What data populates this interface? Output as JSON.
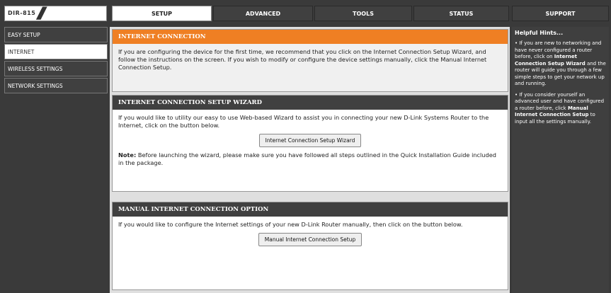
{
  "header": {
    "model": "DIR-815",
    "tabs": [
      "SETUP",
      "ADVANCED",
      "TOOLS",
      "STATUS",
      "SUPPORT"
    ]
  },
  "sidebar": {
    "items": [
      {
        "label": "EASY SETUP"
      },
      {
        "label": "INTERNET"
      },
      {
        "label": "WIRELESS SETTINGS"
      },
      {
        "label": "NETWORK SETTINGS"
      }
    ]
  },
  "main": {
    "section1": {
      "title": "INTERNET CONNECTION",
      "text": "If you are configuring the device for the first time, we recommend that you click on the Internet Connection Setup Wizard, and follow the instructions on the screen. If you wish to modify or configure the device settings manually, click the Manual Internet Connection Setup."
    },
    "section2": {
      "title": "INTERNET CONNECTION SETUP WIZARD",
      "text": "If you would like to utility our easy to use Web-based Wizard to assist you in connecting your new D-Link Systems Router to the Internet, click on the button below.",
      "button": "Internet Connection Setup Wizard",
      "note_label": "Note:",
      "note_text": " Before launching the wizard, please make sure you have followed all steps outlined in the Quick Installation Guide included in the package."
    },
    "section3": {
      "title": "MANUAL INTERNET CONNECTION OPTION",
      "text": "If you would like to configure the Internet settings of your new D-Link Router manually, then click on the button below.",
      "button": "Manual Internet Connection Setup"
    }
  },
  "hints": {
    "title": "Helpful Hints...",
    "hint1_a": "• If you are new to networking and have never configured a router before, click on ",
    "hint1_b": "Internet Connection Setup Wizard",
    "hint1_c": " and the router will guide you through a few simple steps to get your network up and running.",
    "hint2_a": "• If you consider yourself an advanced user and have configured a router before, click ",
    "hint2_b": "Manual Internet Connection Setup",
    "hint2_c": " to input all the settings manually."
  }
}
